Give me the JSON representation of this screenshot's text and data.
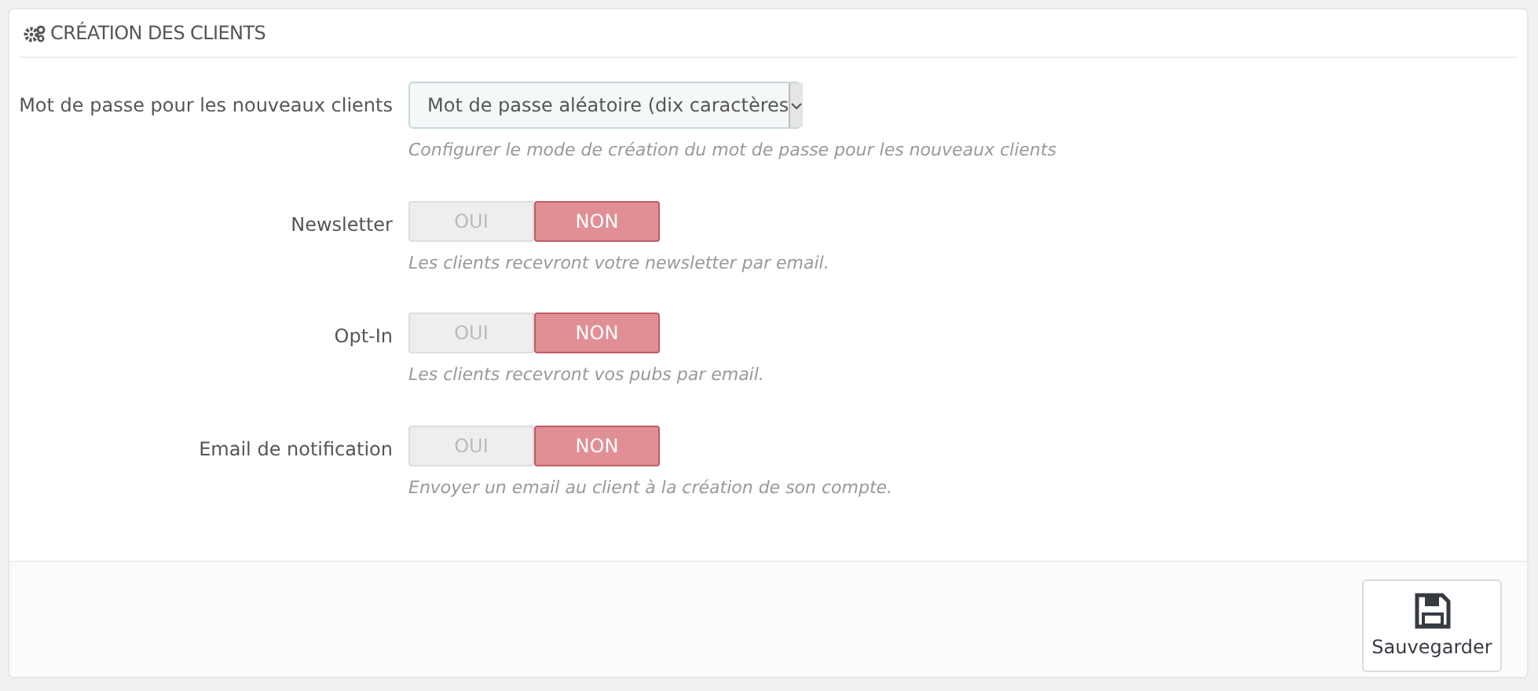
{
  "panel": {
    "title": "CRÉATION DES CLIENTS"
  },
  "fields": [
    {
      "kind": "select",
      "label": "Mot de passe pour les nouveaux clients",
      "value": "Mot de passe aléatoire (dix caractères",
      "help": "Configurer le mode de création du mot de passe pour les nouveaux clients"
    },
    {
      "kind": "toggle",
      "label": "Newsletter",
      "options": [
        {
          "label": "OUI",
          "selected": false
        },
        {
          "label": "NON",
          "selected": true
        }
      ],
      "help": "Les clients recevront votre newsletter par email."
    },
    {
      "kind": "toggle",
      "label": "Opt-In",
      "options": [
        {
          "label": "OUI",
          "selected": false
        },
        {
          "label": "NON",
          "selected": true
        }
      ],
      "help": "Les clients recevront vos pubs par email."
    },
    {
      "kind": "toggle",
      "label": "Email de notification",
      "options": [
        {
          "label": "OUI",
          "selected": false
        },
        {
          "label": "NON",
          "selected": true
        }
      ],
      "help": "Envoyer un email au client à la création de son compte."
    }
  ],
  "footer": {
    "save_button": "Sauvegarder"
  }
}
